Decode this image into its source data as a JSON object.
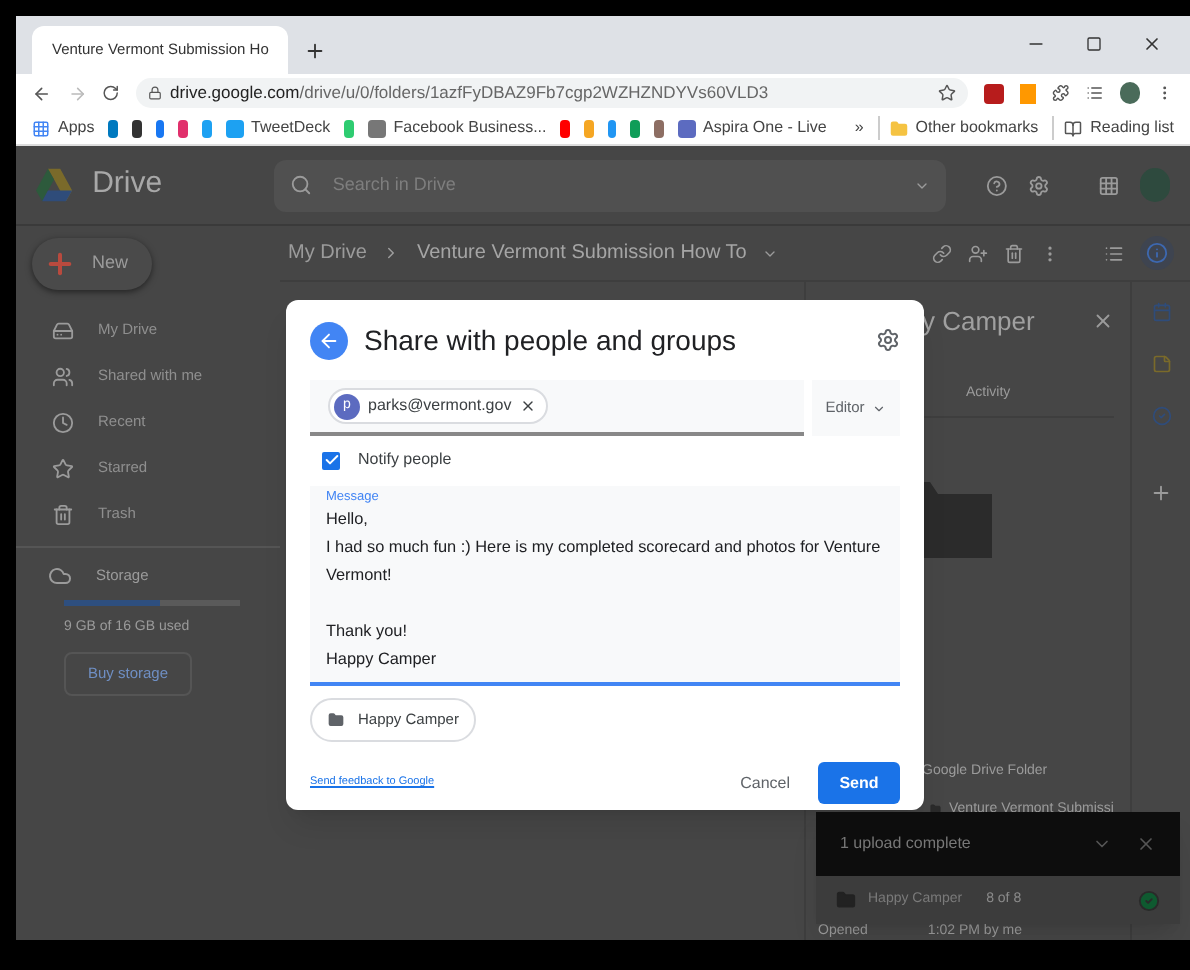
{
  "browser": {
    "tab": {
      "title": "Venture Vermont Submission Ho"
    },
    "url": {
      "host": "drive.google.com",
      "path": "/drive/u/0/folders/1azfFyDBAZ9Fb7cgp2WZHZNDYVs60VLD3"
    },
    "bookmarks": [
      {
        "kind": "apps",
        "label": "Apps"
      },
      {
        "kind": "icon",
        "color": "#0079bf"
      },
      {
        "kind": "icon",
        "color": "#333333"
      },
      {
        "kind": "icon",
        "color": "#1877f2"
      },
      {
        "kind": "icon",
        "color": "#e1306c"
      },
      {
        "kind": "icon",
        "color": "#1da1f2"
      },
      {
        "kind": "link",
        "label": "TweetDeck",
        "color": "#1da1f2"
      },
      {
        "kind": "icon",
        "color": "#2ecc71"
      },
      {
        "kind": "link",
        "label": "Facebook Business...",
        "color": "#777777"
      },
      {
        "kind": "icon",
        "color": "#ff0000"
      },
      {
        "kind": "icon",
        "color": "#f5a623"
      },
      {
        "kind": "icon",
        "color": "#2196f3"
      },
      {
        "kind": "icon",
        "color": "#0f9d58"
      },
      {
        "kind": "icon",
        "color": "#8d6e63"
      },
      {
        "kind": "link",
        "label": "Aspira One - Live",
        "color": "#5c6bc0"
      }
    ],
    "overflow": "»",
    "other_bookmarks": "Other bookmarks",
    "reading_list": "Reading list"
  },
  "drive": {
    "logo": "Drive",
    "search": {
      "placeholder": "Search in Drive"
    },
    "new_button": "New",
    "nav": [
      {
        "kind": "drive",
        "label": "My Drive"
      },
      {
        "kind": "shared",
        "label": "Shared with me"
      },
      {
        "kind": "recent",
        "label": "Recent"
      },
      {
        "kind": "starred",
        "label": "Starred"
      },
      {
        "kind": "trash",
        "label": "Trash"
      }
    ],
    "storage": {
      "label": "Storage",
      "level": 0.55,
      "used": "9 GB of 16 GB used",
      "button": "Buy storage"
    },
    "breadcrumb": [
      "My Drive",
      "Venture Vermont Submission How To"
    ],
    "details": {
      "title": "y Camper",
      "tab": "Activity",
      "rows": [
        "Google Drive Folder",
        "Venture Vermont Submissi"
      ],
      "opened_label": "Opened",
      "opened_value": "1:02 PM by me"
    }
  },
  "dialog": {
    "title": "Share with people and groups",
    "recipient": {
      "initial": "p",
      "email": "parks@vermont.gov"
    },
    "role": "Editor",
    "notify": {
      "label": "Notify people",
      "checked": true
    },
    "message": {
      "label": "Message",
      "value": "Hello,\nI had so much fun :) Here is my completed scorecard and photos for Venture Vermont!\n\nThank you!\nHappy Camper"
    },
    "attachment": "Happy Camper",
    "feedback_link": "Send feedback to Google",
    "buttons": {
      "cancel": "Cancel",
      "send": "Send"
    }
  },
  "upload_toast": {
    "title": "1 upload complete",
    "item": "Happy Camper",
    "progress": "8 of 8",
    "complete": true
  }
}
